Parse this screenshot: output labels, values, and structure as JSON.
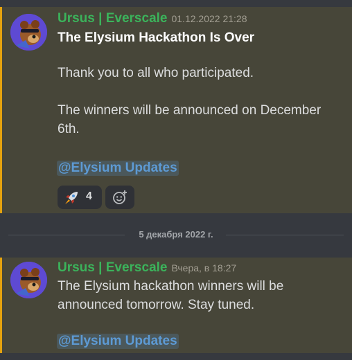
{
  "messages": [
    {
      "author": "Ursus | Everscale",
      "timestamp": "01.12.2022 21:28",
      "title": "The Elysium Hackathon Is Over",
      "paragraph1": "Thank you to all who participated.",
      "paragraph2": "The winners will be announced on December 6th.",
      "mention": "@Elysium Updates",
      "reactions": [
        {
          "emoji": "rocket-emoji",
          "count": "4"
        }
      ],
      "add_reaction_icon": "add-reaction-icon"
    },
    {
      "author": "Ursus | Everscale",
      "timestamp": "Вчера, в 18:27",
      "paragraph1": "The Elysium hackathon winners will be announced tomorrow. Stay tuned.",
      "mention": "@Elysium Updates"
    }
  ],
  "date_divider": "5 декабря 2022 г.",
  "colors": {
    "author": "#3bb35b",
    "accent_bar": "#e5a20e",
    "mention": "#5d9ad4",
    "message_bg": "#474639"
  }
}
